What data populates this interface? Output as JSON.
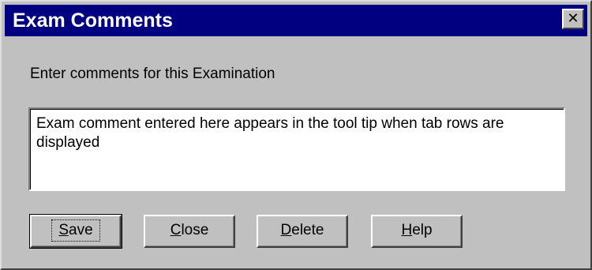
{
  "window": {
    "title": "Exam Comments",
    "close_glyph": "✕",
    "colors": {
      "titlebar": "#000080",
      "face": "#c0c0c0"
    }
  },
  "prompt": "Enter comments for this Examination",
  "comment": {
    "value": "Exam comment entered here appears in the tool tip when tab rows are displayed"
  },
  "buttons": {
    "save": {
      "accel": "S",
      "rest": "ave"
    },
    "close": {
      "accel": "C",
      "rest": "lose"
    },
    "delete": {
      "accel": "D",
      "rest": "elete"
    },
    "help": {
      "accel": "H",
      "rest": "elp"
    }
  }
}
